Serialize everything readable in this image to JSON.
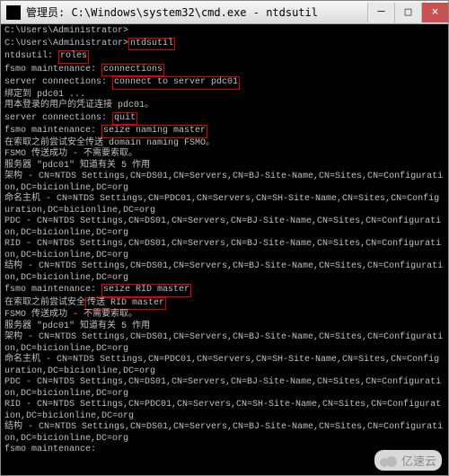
{
  "titlebar": {
    "icon": "cmd-icon",
    "title": "管理员: C:\\Windows\\system32\\cmd.exe - ntdsutil",
    "min_label": "─",
    "max_label": "□",
    "close_label": "×"
  },
  "hl": {
    "ntdsutil": "ntdsutil",
    "roles": "roles",
    "connections": "connections",
    "connect_to_server": "connect to server pdc01",
    "quit": "quit",
    "seize_naming": "seize naming master",
    "seize_rid": "seize RID master",
    "transfer_rid": "传送 RID master"
  },
  "lines": {
    "l01": "C:\\Users\\Administrator>",
    "l02a": "C:\\Users\\Administrator>",
    "l03a": "ntdsutil: ",
    "l04a": "fsmo maintenance: ",
    "l05a": "server connections: ",
    "l06": "绑定到 pdc01 ...",
    "l07": "用本登录的用户的凭证连接 pdc01。",
    "l08a": "server connections: ",
    "l09a": "fsmo maintenance: ",
    "l10": "在索取之前尝试安全传送 domain naming FSMO。",
    "l11": "FSMO 传送成功 - 不需要索取。",
    "l12": "服务器 \"pdc01\" 知道有关 5 作用",
    "l13": "架构 - CN=NTDS Settings,CN=DS01,CN=Servers,CN=BJ-Site-Name,CN=Sites,CN=Configuration,DC=bicionline,DC=org",
    "l14": "命名主机 - CN=NTDS Settings,CN=PDC01,CN=Servers,CN=SH-Site-Name,CN=Sites,CN=Configuration,DC=bicionline,DC=org",
    "l15": "PDC - CN=NTDS Settings,CN=DS01,CN=Servers,CN=BJ-Site-Name,CN=Sites,CN=Configuration,DC=bicionline,DC=org",
    "l16": "RID - CN=NTDS Settings,CN=DS01,CN=Servers,CN=BJ-Site-Name,CN=Sites,CN=Configuration,DC=bicionline,DC=org",
    "l17": "结构 - CN=NTDS Settings,CN=DS01,CN=Servers,CN=BJ-Site-Name,CN=Sites,CN=Configuration,DC=bicionline,DC=org",
    "l18a": "fsmo maintenance: ",
    "l19a": "在索取之前尝试安全",
    "l20": "FSMO 传送成功 - 不需要索取。",
    "l21": "服务器 \"pdc01\" 知道有关 5 作用",
    "l22": "架构 - CN=NTDS Settings,CN=DS01,CN=Servers,CN=BJ-Site-Name,CN=Sites,CN=Configuration,DC=bicionline,DC=org",
    "l23": "命名主机 - CN=NTDS Settings,CN=PDC01,CN=Servers,CN=SH-Site-Name,CN=Sites,CN=Configuration,DC=bicionline,DC=org",
    "l24": "PDC - CN=NTDS Settings,CN=DS01,CN=Servers,CN=BJ-Site-Name,CN=Sites,CN=Configuration,DC=bicionline,DC=org",
    "l25": "RID - CN=NTDS Settings,CN=PDC01,CN=Servers,CN=SH-Site-Name,CN=Sites,CN=Configuration,DC=bicionline,DC=org",
    "l26": "结构 - CN=NTDS Settings,CN=DS01,CN=Servers,CN=BJ-Site-Name,CN=Sites,CN=Configuration,DC=bicionline,DC=org",
    "l27": "fsmo maintenance:"
  },
  "watermark": {
    "text": "亿速云"
  }
}
